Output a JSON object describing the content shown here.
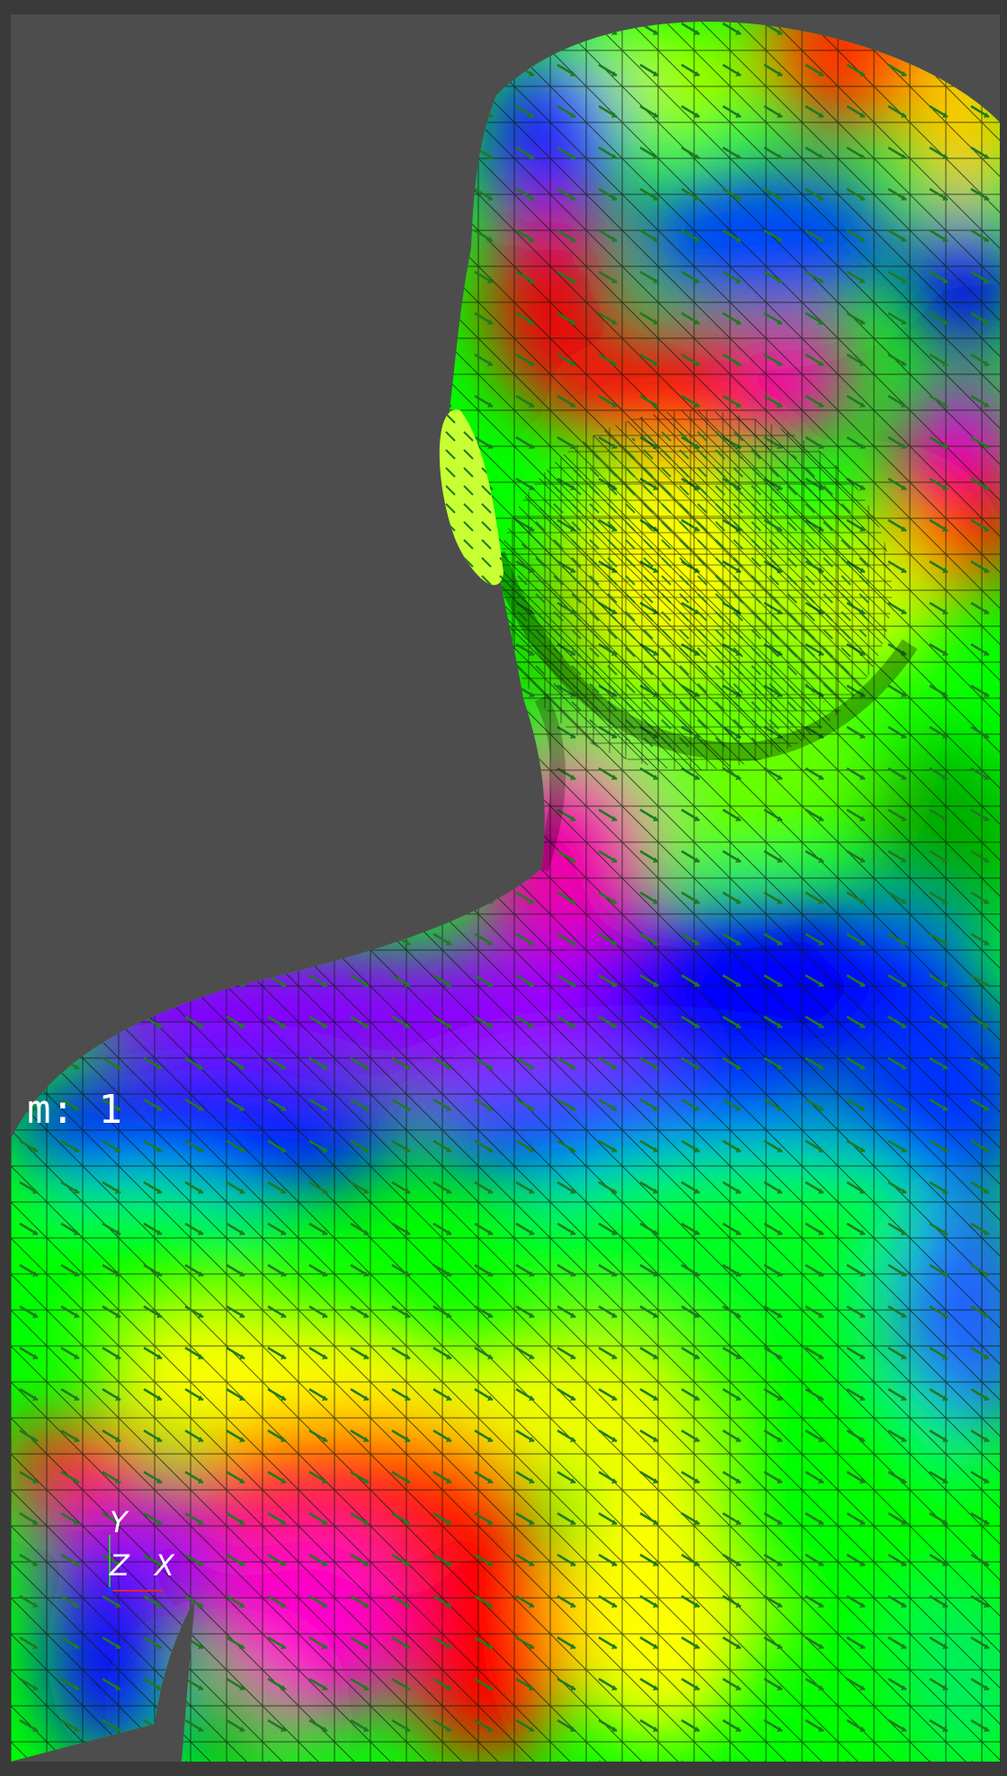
{
  "viewer": {
    "overlay_text": "m: 1",
    "axes": {
      "y_label": "Y",
      "z_label": "Z",
      "x_label": "X"
    }
  },
  "colors": {
    "background": "#4d4d4d",
    "frame": "#3a3a3a",
    "mesh_lines": "#0b1a0b",
    "vector_arrows": "#1f7a1f",
    "axis_y": "#22cc22",
    "axis_x": "#ee2222",
    "axis_z": "#2233ff"
  },
  "scene": {
    "colormap_stops": [
      "#ff0000",
      "#ffff00",
      "#00ff00",
      "#0066ff",
      "#0000ff",
      "#cc00ff",
      "#ff00cc"
    ]
  }
}
